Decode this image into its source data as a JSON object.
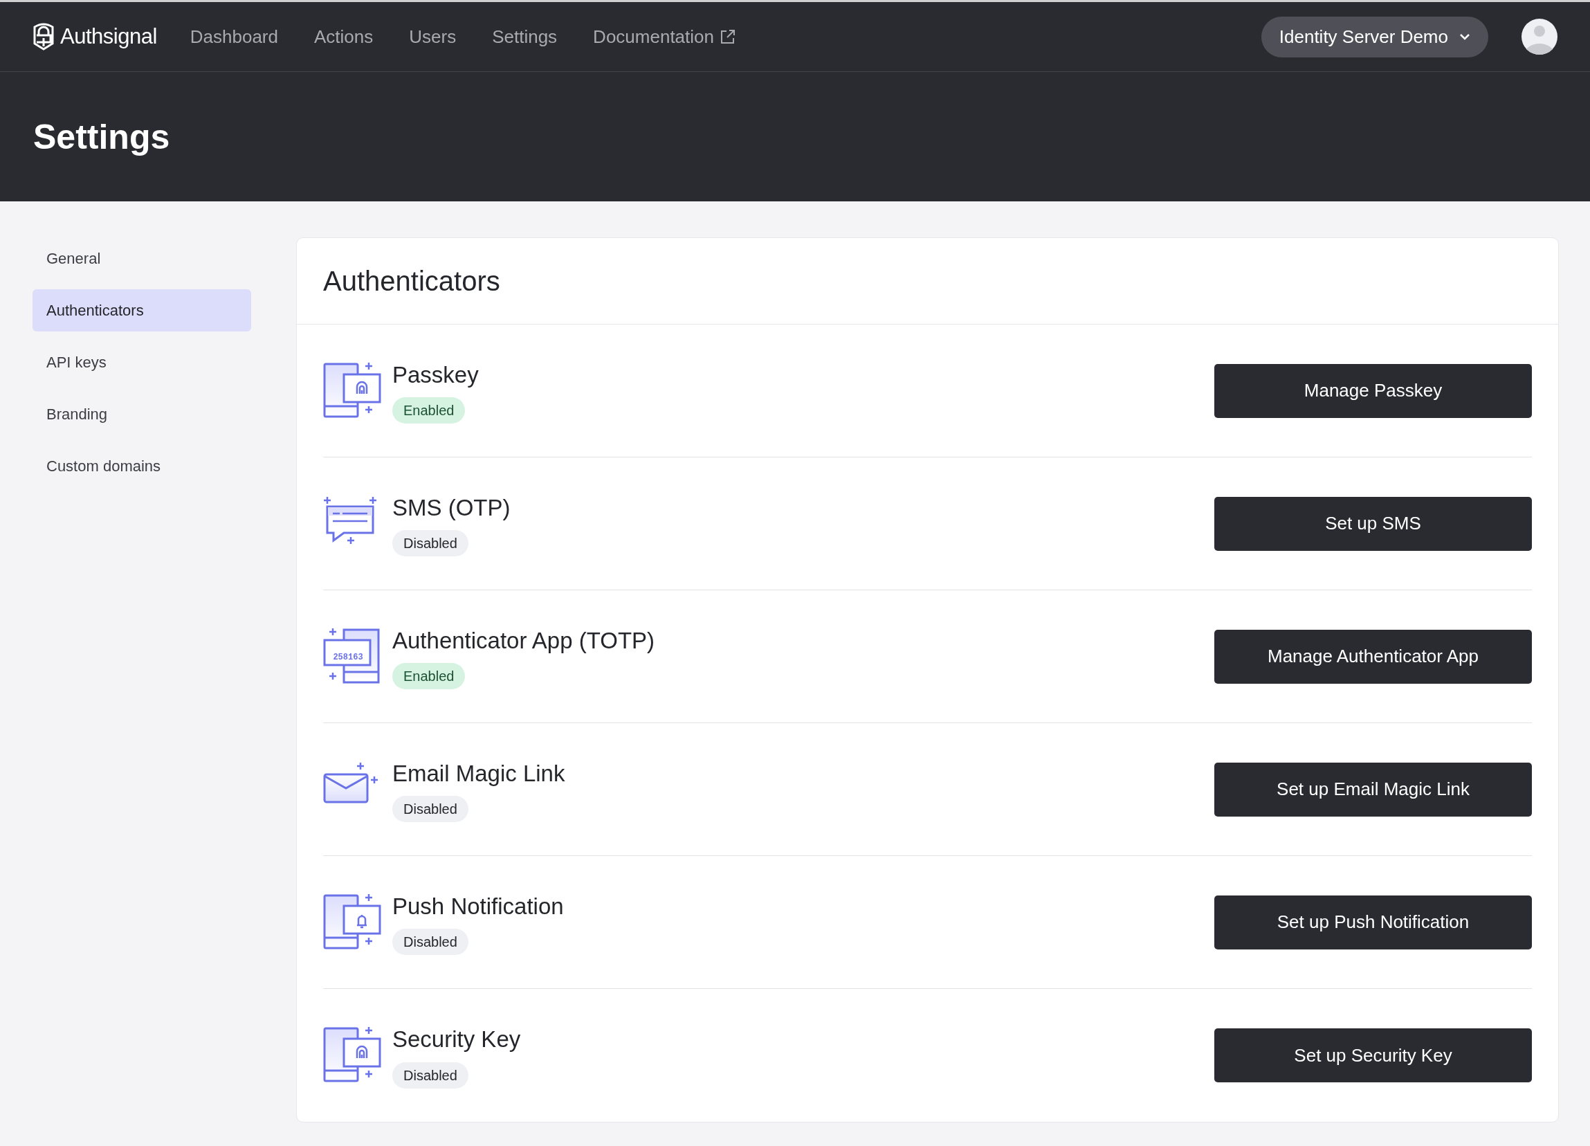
{
  "navbar": {
    "brand": "Authsignal",
    "links": [
      {
        "label": "Dashboard",
        "external": false
      },
      {
        "label": "Actions",
        "external": false
      },
      {
        "label": "Users",
        "external": false
      },
      {
        "label": "Settings",
        "external": false
      },
      {
        "label": "Documentation",
        "external": true
      }
    ],
    "tenant": "Identity Server Demo"
  },
  "header": {
    "title": "Settings"
  },
  "sidebar": {
    "items": [
      {
        "label": "General",
        "selected": false
      },
      {
        "label": "Authenticators",
        "selected": true
      },
      {
        "label": "API keys",
        "selected": false
      },
      {
        "label": "Branding",
        "selected": false
      },
      {
        "label": "Custom domains",
        "selected": false
      }
    ]
  },
  "card": {
    "title": "Authenticators",
    "items": [
      {
        "kind": "device-lock",
        "name": "Passkey",
        "enabled": true,
        "status": "Enabled",
        "button": "Manage Passkey"
      },
      {
        "kind": "chat",
        "name": "SMS (OTP)",
        "enabled": false,
        "status": "Disabled",
        "button": "Set up SMS"
      },
      {
        "kind": "code",
        "code": "258163",
        "name": "Authenticator App (TOTP)",
        "enabled": true,
        "status": "Enabled",
        "button": "Manage Authenticator App"
      },
      {
        "kind": "mail",
        "name": "Email Magic Link",
        "enabled": false,
        "status": "Disabled",
        "button": "Set up Email Magic Link"
      },
      {
        "kind": "device-bell",
        "name": "Push Notification",
        "enabled": false,
        "status": "Disabled",
        "button": "Set up Push Notification"
      },
      {
        "kind": "device-lock",
        "name": "Security Key",
        "enabled": false,
        "status": "Disabled",
        "button": "Set up Security Key"
      }
    ]
  }
}
